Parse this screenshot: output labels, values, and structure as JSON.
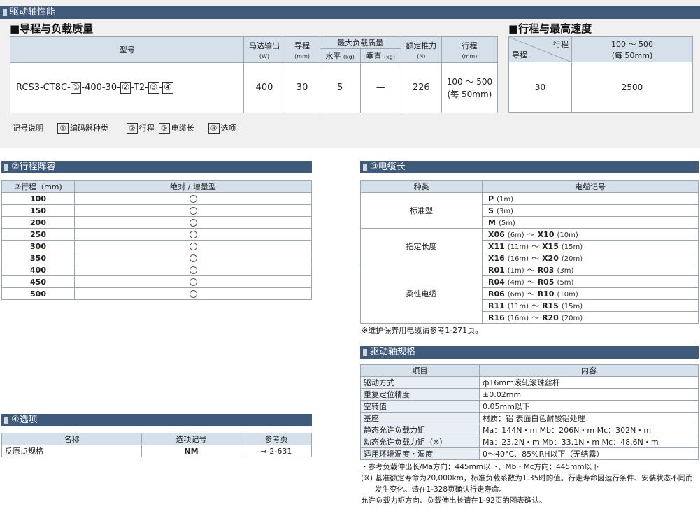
{
  "header": {
    "title": "驱动轴性能"
  },
  "model_section": {
    "title": "■导程与负载质量",
    "col_model": "型号",
    "col_motor": "马达输出",
    "col_motor_unit": "(W)",
    "col_lead": "导程",
    "col_lead_unit": "(mm)",
    "col_max_load": "最大负载质量",
    "col_horizontal": "水平",
    "col_horizontal_unit": "(kg)",
    "col_vertical": "垂直",
    "col_vertical_unit": "(kg)",
    "col_thrust": "额定推力",
    "col_thrust_unit": "(N)",
    "col_stroke": "行程",
    "col_stroke_unit": "(mm)",
    "model_prefix": "RCS3-CT8C-",
    "model_b1": "①",
    "model_mid1": "-400-30-",
    "model_b2": "②",
    "model_mid2": "-T2-",
    "model_b3": "③",
    "model_mid3": "-",
    "model_b4": "④",
    "motor": "400",
    "lead": "30",
    "horizontal": "5",
    "vertical": "—",
    "thrust": "226",
    "stroke_line1": "100 ～ 500",
    "stroke_line2": "(每 50mm)"
  },
  "legend": {
    "label": "记号说明",
    "b1": "①",
    "t1": "编码器种类",
    "b2": "②",
    "t2": "行程",
    "b3": "③",
    "t3": "电缆长",
    "b4": "④",
    "t4": "选项"
  },
  "speed_section": {
    "title": "■行程与最高速度",
    "corner_stroke": "行程",
    "corner_lead": "导程",
    "stroke_range": "100 ～ 500",
    "stroke_step": "(每 50mm)",
    "lead": "30",
    "speed": "2500"
  },
  "stroke_table": {
    "bar": "②行程阵容",
    "col_stroke": "②行程（mm)",
    "col_type": "绝对 / 增量型",
    "rows": [
      "100",
      "150",
      "200",
      "250",
      "300",
      "350",
      "400",
      "450",
      "500"
    ]
  },
  "cable_table": {
    "bar": "③电缆长",
    "col_kind": "种类",
    "col_code": "电缆记号",
    "groups": [
      {
        "kind": "标准型",
        "rows": [
          {
            "c1": "P",
            "u1": "(1m)",
            "c2": "",
            "u2": ""
          },
          {
            "c1": "S",
            "u1": "(3m)",
            "c2": "",
            "u2": ""
          },
          {
            "c1": "M",
            "u1": "(5m)",
            "c2": "",
            "u2": ""
          }
        ]
      },
      {
        "kind": "指定长度",
        "rows": [
          {
            "c1": "X06",
            "u1": "(6m)",
            "c2": "X10",
            "u2": "(10m)"
          },
          {
            "c1": "X11",
            "u1": "(11m)",
            "c2": "X15",
            "u2": "(15m)"
          },
          {
            "c1": "X16",
            "u1": "(16m)",
            "c2": "X20",
            "u2": "(20m)"
          }
        ]
      },
      {
        "kind": "柔性电缆",
        "rows": [
          {
            "c1": "R01",
            "u1": "(1m)",
            "c2": "R03",
            "u2": "(3m)"
          },
          {
            "c1": "R04",
            "u1": "(4m)",
            "c2": "R05",
            "u2": "(5m)"
          },
          {
            "c1": "R06",
            "u1": "(6m)",
            "c2": "R10",
            "u2": "(10m)"
          },
          {
            "c1": "R11",
            "u1": "(11m)",
            "c2": "R15",
            "u2": "(15m)"
          },
          {
            "c1": "R16",
            "u1": "(16m)",
            "c2": "R20",
            "u2": "(20m)"
          }
        ]
      }
    ],
    "tilde": "～",
    "note": "※维护保养用电缆请参考1-271页。"
  },
  "spec_table": {
    "bar": "驱动轴规格",
    "col_item": "项目",
    "col_content": "内容",
    "rows": [
      {
        "item": "驱动方式",
        "content": "ф16mm滚轧滚珠丝杆"
      },
      {
        "item": "重复定位精度",
        "content": "±0.02mm"
      },
      {
        "item": "空转值",
        "content": "0.05mm以下"
      },
      {
        "item": "基座",
        "content": "材质：铝  表面白色耐酸铝处理"
      },
      {
        "item": "静态允许负载力矩",
        "content": "Ma：144N・m   Mb：206N・m   Mc：302N・m"
      },
      {
        "item": "动态允许负载力矩（※）",
        "content": "Ma：23.2N・m   Mb：33.1N・m   Mc：48.6N・m"
      },
      {
        "item": "适用环境温度・湿度",
        "content": "0～40°C、85%RH以下（无结露）"
      }
    ],
    "notes": [
      "・参考负载伸出长/Ma方向：445mm以下、Mb・Mc方向：445mm以下",
      "(※) 基准额定寿命为20,000km，标准负载系数为1.35时的值。行走寿命因运行条件、安装状态不同而",
      "      发生变化。请在1-328页确认行走寿命。",
      "允许负载力矩方向、负载伸出长请在1-92页的图表确认。"
    ]
  },
  "options_table": {
    "bar": "④选项",
    "col_name": "名称",
    "col_code": "选项记号",
    "col_page": "参考页",
    "rows": [
      {
        "name": "反原点规格",
        "code": "NM",
        "page": "→ 2-631"
      }
    ]
  }
}
